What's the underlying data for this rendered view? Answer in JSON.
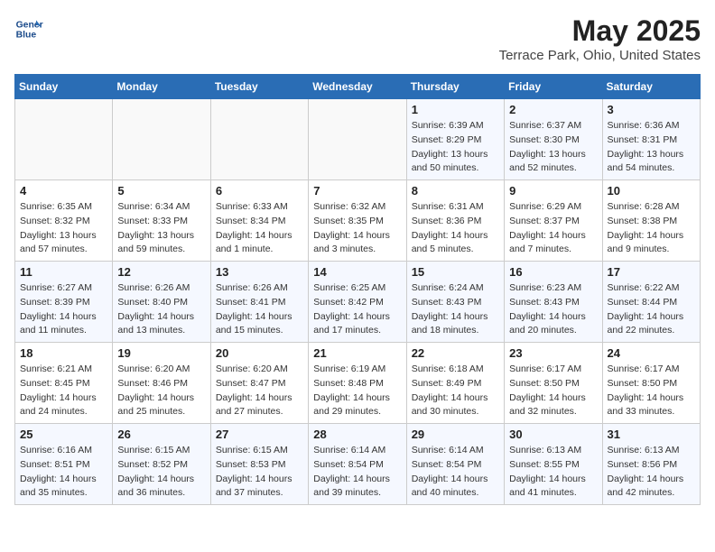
{
  "header": {
    "logo_line1": "General",
    "logo_line2": "Blue",
    "title": "May 2025",
    "subtitle": "Terrace Park, Ohio, United States"
  },
  "days_of_week": [
    "Sunday",
    "Monday",
    "Tuesday",
    "Wednesday",
    "Thursday",
    "Friday",
    "Saturday"
  ],
  "weeks": [
    [
      {
        "num": "",
        "info": ""
      },
      {
        "num": "",
        "info": ""
      },
      {
        "num": "",
        "info": ""
      },
      {
        "num": "",
        "info": ""
      },
      {
        "num": "1",
        "info": "Sunrise: 6:39 AM\nSunset: 8:29 PM\nDaylight: 13 hours\nand 50 minutes."
      },
      {
        "num": "2",
        "info": "Sunrise: 6:37 AM\nSunset: 8:30 PM\nDaylight: 13 hours\nand 52 minutes."
      },
      {
        "num": "3",
        "info": "Sunrise: 6:36 AM\nSunset: 8:31 PM\nDaylight: 13 hours\nand 54 minutes."
      }
    ],
    [
      {
        "num": "4",
        "info": "Sunrise: 6:35 AM\nSunset: 8:32 PM\nDaylight: 13 hours\nand 57 minutes."
      },
      {
        "num": "5",
        "info": "Sunrise: 6:34 AM\nSunset: 8:33 PM\nDaylight: 13 hours\nand 59 minutes."
      },
      {
        "num": "6",
        "info": "Sunrise: 6:33 AM\nSunset: 8:34 PM\nDaylight: 14 hours\nand 1 minute."
      },
      {
        "num": "7",
        "info": "Sunrise: 6:32 AM\nSunset: 8:35 PM\nDaylight: 14 hours\nand 3 minutes."
      },
      {
        "num": "8",
        "info": "Sunrise: 6:31 AM\nSunset: 8:36 PM\nDaylight: 14 hours\nand 5 minutes."
      },
      {
        "num": "9",
        "info": "Sunrise: 6:29 AM\nSunset: 8:37 PM\nDaylight: 14 hours\nand 7 minutes."
      },
      {
        "num": "10",
        "info": "Sunrise: 6:28 AM\nSunset: 8:38 PM\nDaylight: 14 hours\nand 9 minutes."
      }
    ],
    [
      {
        "num": "11",
        "info": "Sunrise: 6:27 AM\nSunset: 8:39 PM\nDaylight: 14 hours\nand 11 minutes."
      },
      {
        "num": "12",
        "info": "Sunrise: 6:26 AM\nSunset: 8:40 PM\nDaylight: 14 hours\nand 13 minutes."
      },
      {
        "num": "13",
        "info": "Sunrise: 6:26 AM\nSunset: 8:41 PM\nDaylight: 14 hours\nand 15 minutes."
      },
      {
        "num": "14",
        "info": "Sunrise: 6:25 AM\nSunset: 8:42 PM\nDaylight: 14 hours\nand 17 minutes."
      },
      {
        "num": "15",
        "info": "Sunrise: 6:24 AM\nSunset: 8:43 PM\nDaylight: 14 hours\nand 18 minutes."
      },
      {
        "num": "16",
        "info": "Sunrise: 6:23 AM\nSunset: 8:43 PM\nDaylight: 14 hours\nand 20 minutes."
      },
      {
        "num": "17",
        "info": "Sunrise: 6:22 AM\nSunset: 8:44 PM\nDaylight: 14 hours\nand 22 minutes."
      }
    ],
    [
      {
        "num": "18",
        "info": "Sunrise: 6:21 AM\nSunset: 8:45 PM\nDaylight: 14 hours\nand 24 minutes."
      },
      {
        "num": "19",
        "info": "Sunrise: 6:20 AM\nSunset: 8:46 PM\nDaylight: 14 hours\nand 25 minutes."
      },
      {
        "num": "20",
        "info": "Sunrise: 6:20 AM\nSunset: 8:47 PM\nDaylight: 14 hours\nand 27 minutes."
      },
      {
        "num": "21",
        "info": "Sunrise: 6:19 AM\nSunset: 8:48 PM\nDaylight: 14 hours\nand 29 minutes."
      },
      {
        "num": "22",
        "info": "Sunrise: 6:18 AM\nSunset: 8:49 PM\nDaylight: 14 hours\nand 30 minutes."
      },
      {
        "num": "23",
        "info": "Sunrise: 6:17 AM\nSunset: 8:50 PM\nDaylight: 14 hours\nand 32 minutes."
      },
      {
        "num": "24",
        "info": "Sunrise: 6:17 AM\nSunset: 8:50 PM\nDaylight: 14 hours\nand 33 minutes."
      }
    ],
    [
      {
        "num": "25",
        "info": "Sunrise: 6:16 AM\nSunset: 8:51 PM\nDaylight: 14 hours\nand 35 minutes."
      },
      {
        "num": "26",
        "info": "Sunrise: 6:15 AM\nSunset: 8:52 PM\nDaylight: 14 hours\nand 36 minutes."
      },
      {
        "num": "27",
        "info": "Sunrise: 6:15 AM\nSunset: 8:53 PM\nDaylight: 14 hours\nand 37 minutes."
      },
      {
        "num": "28",
        "info": "Sunrise: 6:14 AM\nSunset: 8:54 PM\nDaylight: 14 hours\nand 39 minutes."
      },
      {
        "num": "29",
        "info": "Sunrise: 6:14 AM\nSunset: 8:54 PM\nDaylight: 14 hours\nand 40 minutes."
      },
      {
        "num": "30",
        "info": "Sunrise: 6:13 AM\nSunset: 8:55 PM\nDaylight: 14 hours\nand 41 minutes."
      },
      {
        "num": "31",
        "info": "Sunrise: 6:13 AM\nSunset: 8:56 PM\nDaylight: 14 hours\nand 42 minutes."
      }
    ]
  ]
}
